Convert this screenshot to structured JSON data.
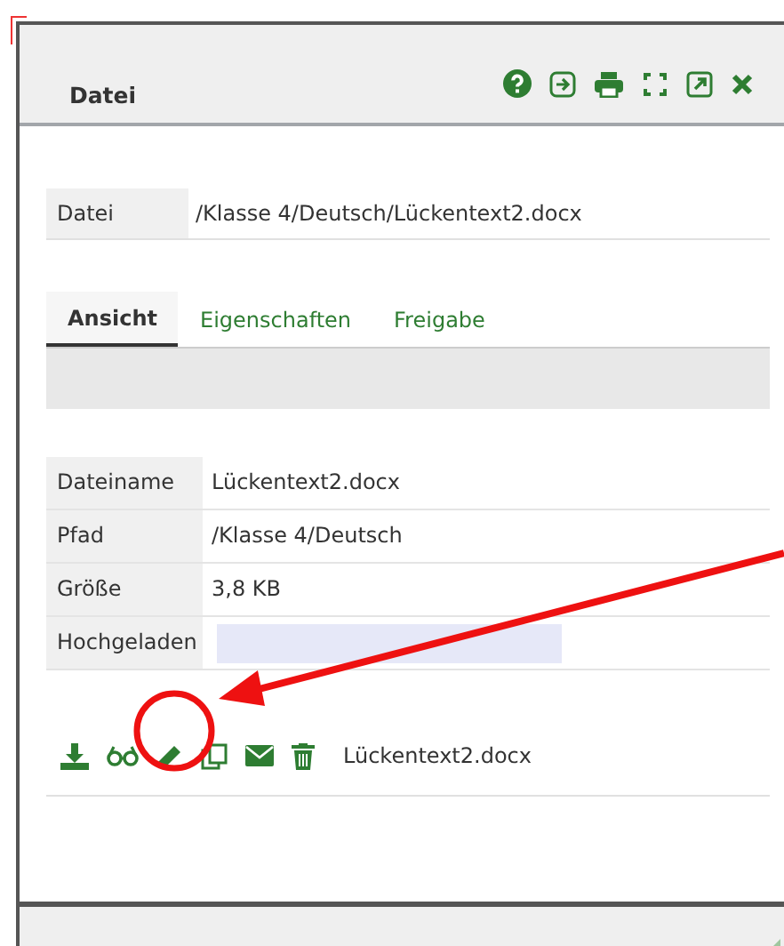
{
  "window": {
    "title": "Datei"
  },
  "file_path": {
    "label": "Datei",
    "value": "/Klasse 4/Deutsch/Lückentext2.docx"
  },
  "tabs": [
    {
      "label": "Ansicht",
      "selected": true
    },
    {
      "label": "Eigenschaften",
      "selected": false
    },
    {
      "label": "Freigabe",
      "selected": false
    }
  ],
  "details": [
    {
      "label": "Dateiname",
      "kind": "text",
      "value": "Lückentext2.docx"
    },
    {
      "label": "Pfad",
      "kind": "text",
      "value": "/Klasse 4/Deutsch"
    },
    {
      "label": "Größe",
      "kind": "text",
      "value": "3,8 KB"
    },
    {
      "label": "Hochgeladen",
      "kind": "redacted"
    }
  ],
  "actions": {
    "file_name": "Lückentext2.docx"
  }
}
